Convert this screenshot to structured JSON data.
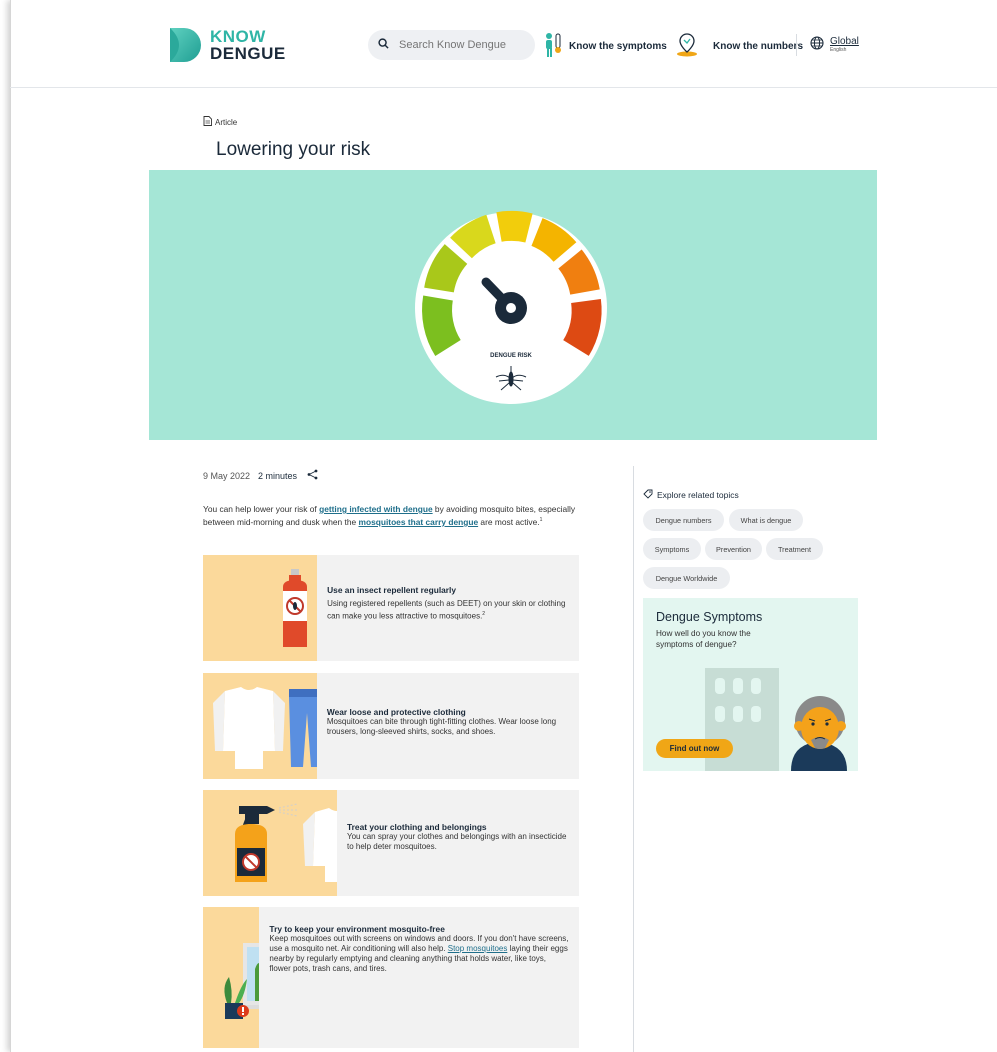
{
  "brand": {
    "line1": "KNOW",
    "line2": "DENGUE"
  },
  "search": {
    "placeholder": "Search Know Dengue"
  },
  "nav": {
    "symptoms": "Know the symptoms",
    "numbers": "Know the numbers",
    "region": "Global",
    "language": "English"
  },
  "article": {
    "type": "Article",
    "title": "Lowering your risk",
    "hero_caption": "DENGUE RISK",
    "date": "9 May 2022",
    "duration": "2 minutes",
    "intro": {
      "p1": "You can help lower your risk of ",
      "link1": "getting infected with dengue",
      "p2": " by avoiding mosquito bites, especially between mid-morning and dusk when the ",
      "link2": "mosquitoes that carry dengue",
      "p3": " are most active.",
      "ref": "1"
    }
  },
  "tips": [
    {
      "title": "Use an insect repellent regularly",
      "body": "Using registered repellents (such as DEET) on your skin or clothing can make you less attractive to mosquitoes.",
      "ref": "2"
    },
    {
      "title": "Wear loose and protective clothing",
      "body": "Mosquitoes can bite through tight-fitting clothes. Wear loose long trousers, long-sleeved shirts, socks, and shoes."
    },
    {
      "title": "Treat your clothing and belongings",
      "body": "You can spray your clothes and belongings with an insecticide to help deter mosquitoes."
    },
    {
      "title": "Try to keep your environment mosquito-free",
      "body_a": "Keep mosquitoes out with screens on windows and doors. If you don't have screens, use a mosquito net. Air conditioning will also help. ",
      "link": "Stop mosquitoes",
      "body_b": " laying their eggs nearby by regularly emptying and cleaning anything that holds water, like toys, flower pots, trash cans, and tires."
    }
  ],
  "sidebar": {
    "explore_title": "Explore related topics",
    "topics": [
      "Dengue numbers",
      "What is dengue",
      "Symptoms",
      "Prevention",
      "Treatment",
      "Dengue Worldwide"
    ],
    "promo": {
      "title": "Dengue Symptoms",
      "text": "How well do you know the symptoms of dengue?",
      "cta": "Find out now"
    }
  },
  "colors": {
    "brand_teal": "#2fb5a6",
    "navy": "#1b2a3a",
    "hero_bg": "#a5e6d6",
    "card_yellow": "#fbd99b",
    "cta_orange": "#f0a616",
    "link": "#1f6f8b"
  },
  "icons": [
    "search-icon",
    "thermometer-icon",
    "map-pin-icon",
    "globe-icon",
    "document-icon",
    "share-icon",
    "tag-icon"
  ]
}
